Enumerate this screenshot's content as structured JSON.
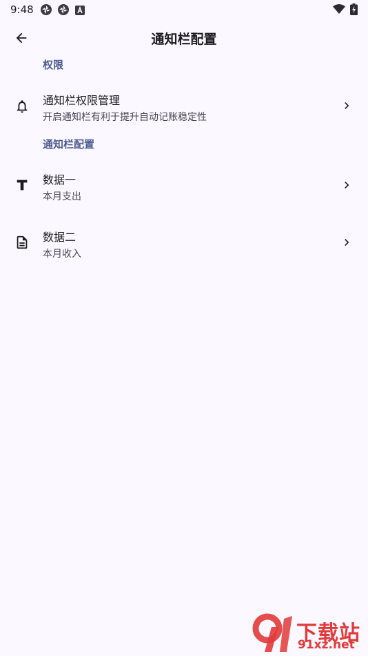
{
  "status_bar": {
    "time": "9:48",
    "icons": [
      "aperture-icon",
      "aperture-icon",
      "app-a-icon",
      "wifi-icon",
      "battery-charging-icon"
    ]
  },
  "header": {
    "title": "通知栏配置",
    "back_icon": "arrow-left-icon"
  },
  "sections": [
    {
      "header": "权限",
      "items": [
        {
          "icon": "bell-icon",
          "title": "通知栏权限管理",
          "subtitle": "开启通知栏有利于提升自动记账稳定性"
        }
      ]
    },
    {
      "header": "通知栏配置",
      "items": [
        {
          "icon": "text-format-icon",
          "title": "数据一",
          "subtitle": "本月支出"
        },
        {
          "icon": "document-icon",
          "title": "数据二",
          "subtitle": "本月收入"
        }
      ]
    }
  ],
  "watermark": {
    "logo_text": "9",
    "title": "下载站",
    "site": "91xz.net"
  },
  "colors": {
    "background": "#fcf8ff",
    "section_header": "#4c5c92",
    "text_primary": "#1c1b1f",
    "text_secondary": "#46464f",
    "watermark": "#e23a3a"
  }
}
